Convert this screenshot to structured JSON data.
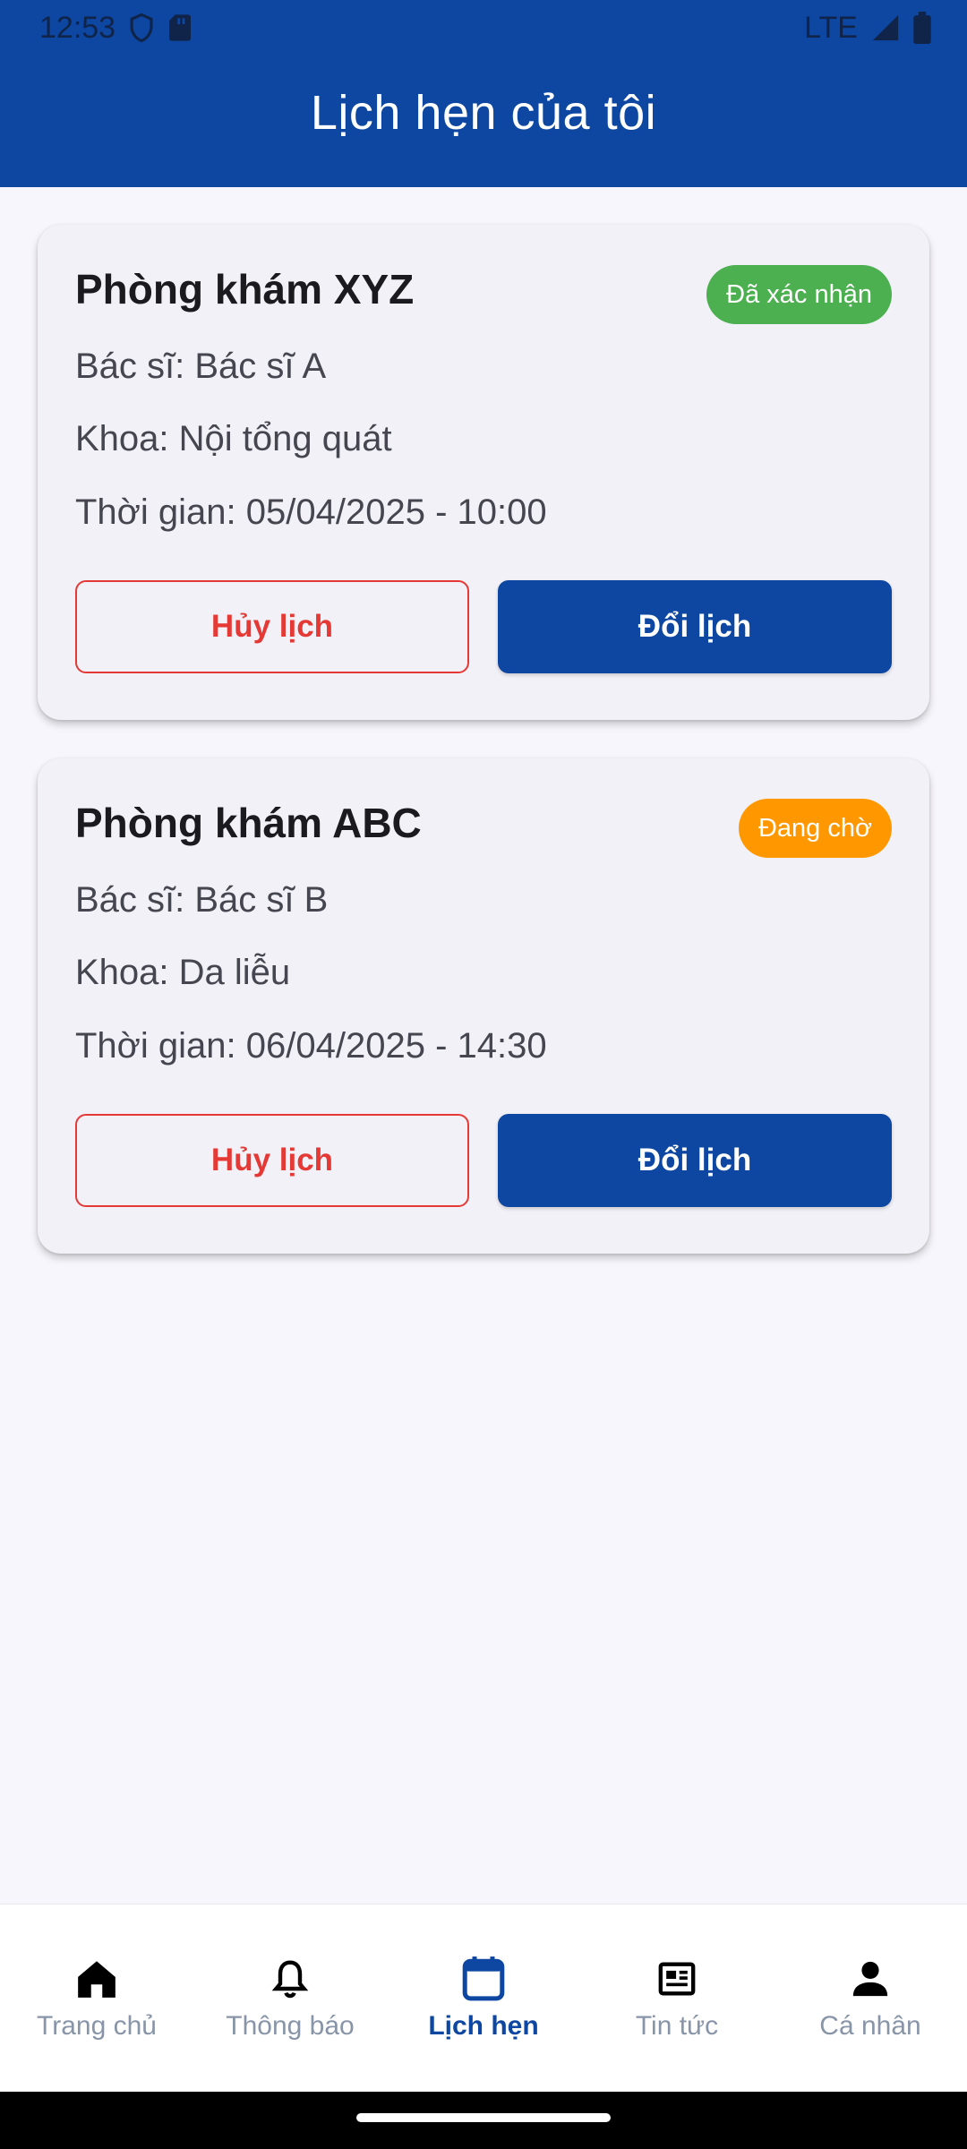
{
  "status_bar": {
    "time": "12:53",
    "network": "LTE",
    "icons": [
      "shield-icon",
      "sd-card-icon",
      "signal-icon",
      "battery-icon"
    ]
  },
  "header": {
    "title": "Lịch hẹn của tôi"
  },
  "colors": {
    "primary": "#0d47a1",
    "confirmed": "#4caf50",
    "pending": "#ff9800",
    "cancel": "#e53935"
  },
  "appointments": [
    {
      "clinic": "Phòng khám XYZ",
      "status": "Đã xác nhận",
      "doctor": "Bác sĩ: Bác sĩ A",
      "department": "Khoa: Nội tổng quát",
      "time": "Thời gian: 05/04/2025 - 10:00",
      "cancel_label": "Hủy lịch",
      "reschedule_label": "Đổi lịch"
    },
    {
      "clinic": "Phòng khám ABC",
      "status": "Đang chờ",
      "doctor": "Bác sĩ: Bác sĩ B",
      "department": "Khoa: Da liễu",
      "time": "Thời gian: 06/04/2025 - 14:30",
      "cancel_label": "Hủy lịch",
      "reschedule_label": "Đổi lịch"
    }
  ],
  "bottom_nav": {
    "items": [
      {
        "label": "Trang chủ",
        "icon": "home-icon"
      },
      {
        "label": "Thông báo",
        "icon": "bell-icon"
      },
      {
        "label": "Lịch hẹn",
        "icon": "calendar-icon",
        "active": true
      },
      {
        "label": "Tin tức",
        "icon": "newspaper-icon"
      },
      {
        "label": "Cá nhân",
        "icon": "person-icon"
      }
    ]
  }
}
